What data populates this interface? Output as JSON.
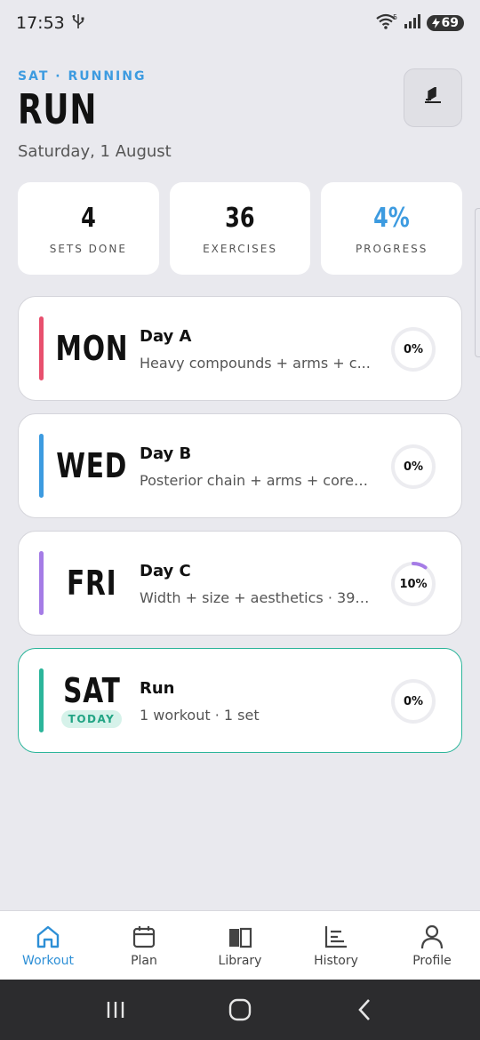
{
  "status_bar": {
    "time": "17:53",
    "battery": "69"
  },
  "header": {
    "kicker": "SAT · RUNNING",
    "title": "RUN",
    "date": "Saturday, 1 August"
  },
  "stats": [
    {
      "value": "4",
      "label": "SETS DONE",
      "accent": false
    },
    {
      "value": "36",
      "label": "EXERCISES",
      "accent": false
    },
    {
      "value": "4%",
      "label": "PROGRESS",
      "accent": true
    }
  ],
  "days": [
    {
      "abbr": "MON",
      "name": "Day A",
      "desc": "Heavy compounds + arms + c...",
      "progress_label": "0%",
      "progress": 0,
      "color": "#e8506e",
      "today": false
    },
    {
      "abbr": "WED",
      "name": "Day B",
      "desc": "Posterior chain + arms + core ...",
      "progress_label": "0%",
      "progress": 0,
      "color": "#3d9be0",
      "today": false
    },
    {
      "abbr": "FRI",
      "name": "Day C",
      "desc": "Width + size + aesthetics · 39 ...",
      "progress_label": "10%",
      "progress": 0.1,
      "color": "#a57ce6",
      "today": false
    },
    {
      "abbr": "SAT",
      "name": "Run",
      "desc": "1 workout · 1 set",
      "progress_label": "0%",
      "progress": 0,
      "color": "#2bb59a",
      "today": true,
      "badge": "TODAY"
    }
  ],
  "nav": [
    {
      "label": "Workout",
      "icon": "home-icon",
      "active": true
    },
    {
      "label": "Plan",
      "icon": "calendar-icon",
      "active": false
    },
    {
      "label": "Library",
      "icon": "book-icon",
      "active": false
    },
    {
      "label": "History",
      "icon": "chart-icon",
      "active": false
    },
    {
      "label": "Profile",
      "icon": "person-icon",
      "active": false
    }
  ],
  "colors": {
    "accent": "#3d9be0",
    "today": "#2bb59a",
    "ring_track": "#ececf0",
    "ring_fill": "#a57ce6"
  }
}
